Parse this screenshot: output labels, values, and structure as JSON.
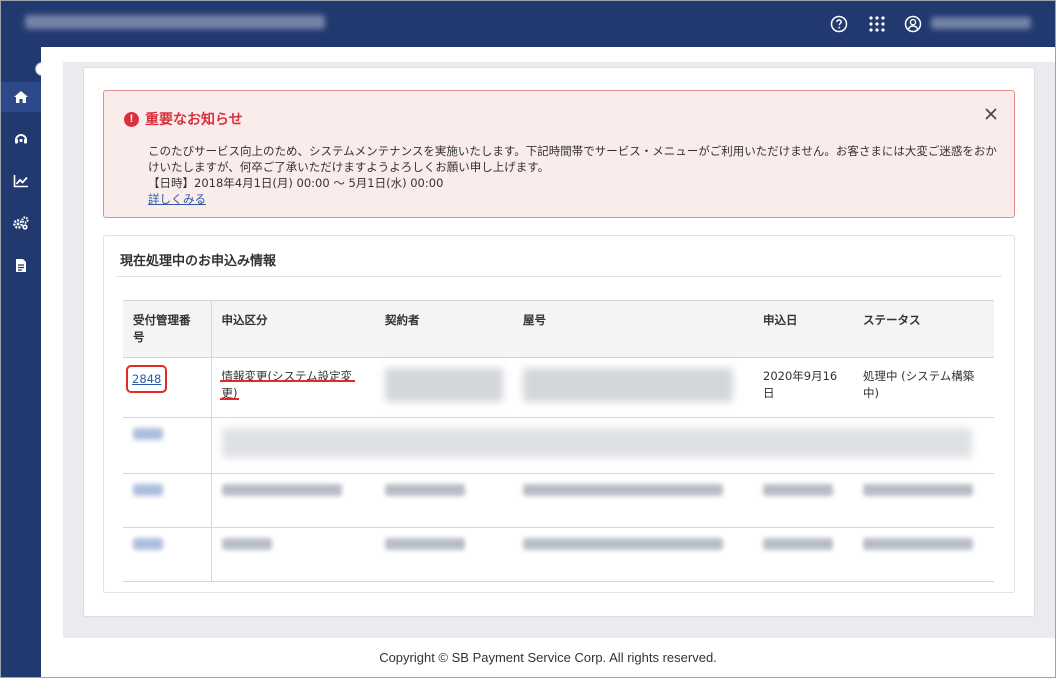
{
  "header": {
    "help_icon": "question-circle-icon",
    "apps_icon": "grid-icon",
    "user_icon": "user-circle-icon"
  },
  "sidebar": {
    "items": [
      {
        "icon": "home-icon"
      },
      {
        "icon": "support-icon"
      },
      {
        "icon": "chart-icon"
      },
      {
        "icon": "gears-icon"
      },
      {
        "icon": "document-icon"
      }
    ],
    "toggle_glyph": "›"
  },
  "notice": {
    "title": "重要なお知らせ",
    "line1": "このたびサービス向上のため、システムメンテナンスを実施いたします。下記時間帯でサービス・メニューがご利用いただけません。お客さまには大変ご迷惑をおか",
    "line2": "けいたしますが、何卒ご了承いただけますようよろしくお願い申し上げます。",
    "line3": "【日時】2018年4月1日(月) 00:00 ～ 5月1日(水) 00:00",
    "link": "詳しくみる",
    "close": "×"
  },
  "section": {
    "title": "現在処理中のお申込み情報"
  },
  "table": {
    "headers": {
      "id": "受付管理番号",
      "type": "申込区分",
      "contractor": "契約者",
      "trade_name": "屋号",
      "date": "申込日",
      "status": "ステータス"
    },
    "row1": {
      "id": "2848",
      "type": "情報変更(システム設定変更)",
      "date": "2020年9月16日",
      "status": "処理中 (システム構築中)"
    }
  },
  "footer": {
    "copyright": "Copyright © SB Payment Service Corp. All rights reserved."
  },
  "colors": {
    "navy": "#22396f",
    "alert_red": "#d9303e",
    "link_blue": "#2b5aa3"
  }
}
